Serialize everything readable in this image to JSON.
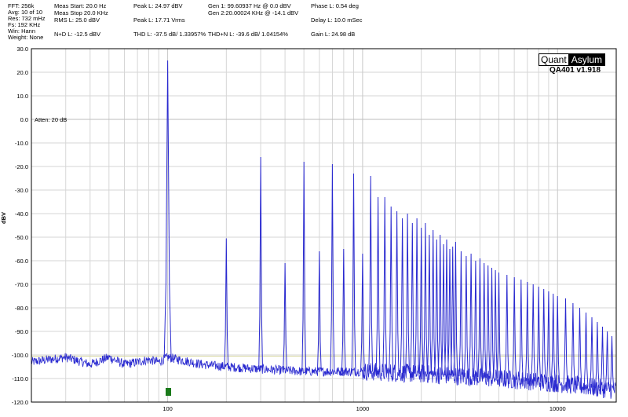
{
  "header": {
    "col1": [
      "FFT: 256k",
      "Avg: 10 of 10",
      "Res: 732 mHz",
      "Fs: 192 KHz",
      "Win: Hann",
      "Weight: None"
    ],
    "col2": [
      "Meas Start: 20.0 Hz",
      "Meas Stop 20.0 KHz",
      "RMS L: 25.0 dBV",
      "",
      "N+D L: -12.5 dBV"
    ],
    "col3": [
      "Peak L: 24.97 dBV",
      "",
      "Peak L: 17.71 Vrms",
      "",
      "THD L: -37.5 dB/ 1.33957%"
    ],
    "col4": [
      "Gen 1: 99.60937 Hz @ 0.0  dBV",
      "Gen 2:20.00024 KHz @ -14.1  dBV",
      "",
      "",
      "THD+N L: -39.6 dB/ 1.04154%"
    ],
    "col5": [
      "Phase L: 0.54 deg",
      "",
      "Delay L: 10.0 mSec",
      "",
      "Gain L: 24.98 dB"
    ]
  },
  "logo": {
    "quant": "Quant",
    "asylum": "Asylum",
    "version": "QA401 v1.918"
  },
  "annotation": "Atten: 20 dB",
  "colors": {
    "trace": "#2a2ad0",
    "grid": "#d6d6d6",
    "ref_line": "#d8d8a0",
    "marker": "#1a7a1a"
  },
  "chart_data": {
    "type": "line",
    "title": "",
    "xlabel": "",
    "ylabel": "dBV",
    "xscale": "log",
    "xlim": [
      20,
      20000
    ],
    "ylim": [
      -120,
      30
    ],
    "yticks": [
      30,
      20,
      10,
      0,
      -10,
      -20,
      -30,
      -40,
      -50,
      -60,
      -70,
      -80,
      -90,
      -100,
      -110,
      -120
    ],
    "ytick_labels": [
      "30.0",
      "20.0",
      "10.0",
      "0.0",
      "-10.0",
      "-20.0",
      "-30.0",
      "-40.0",
      "-50.0",
      "-60.0",
      "-70.0",
      "-80.0",
      "-90.0",
      "-100.0",
      "-110.0",
      "-120.0"
    ],
    "xticks": [
      100,
      1000,
      10000
    ],
    "xtick_labels": [
      "100",
      "1000",
      "10000"
    ],
    "grid": true,
    "reference_line_dbv": -100.5,
    "series": [
      {
        "harmonics": {
          "freq_hz": [
            100,
            200,
            300,
            400,
            500,
            600,
            700,
            800,
            900,
            1000,
            1100,
            1200,
            1300,
            1400,
            1500,
            1600,
            1700,
            1800,
            1900,
            2000,
            2100,
            2200,
            2300,
            2400,
            2500,
            2600,
            2700,
            2800,
            2900,
            3000,
            3200,
            3400,
            3600,
            3800,
            4000,
            4200,
            4400,
            4600,
            4800,
            5000,
            5500,
            6000,
            6500,
            7000,
            7500,
            8000,
            8500,
            9000,
            9500,
            10000,
            11000,
            12000,
            13000,
            14000,
            15000,
            16000,
            17000,
            18000,
            19000
          ],
          "level_dbv": [
            25,
            -50.5,
            -16,
            -61,
            -18,
            -56,
            -19,
            -55,
            -23,
            -57,
            -24,
            -33,
            -33,
            -37,
            -39,
            -42,
            -40,
            -44,
            -42,
            -46,
            -44,
            -49,
            -47,
            -51,
            -49,
            -53,
            -51,
            -55,
            -54,
            -52,
            -56,
            -58,
            -57,
            -60,
            -59,
            -61,
            -62,
            -63,
            -64,
            -65,
            -66,
            -67,
            -68,
            -69,
            -70,
            -71,
            -72,
            -73,
            -74,
            -75,
            -76,
            -78,
            -80,
            -82,
            -84,
            -86,
            -88,
            -90,
            -92
          ]
        },
        "noise_floor": {
          "freq_hz": [
            20,
            30,
            40,
            50,
            60,
            70,
            80,
            90,
            100,
            150,
            200,
            300,
            500,
            1000,
            2000,
            5000,
            10000,
            20000
          ],
          "level_dbv": [
            -103,
            -101,
            -104,
            -101,
            -104,
            -103,
            -102,
            -103,
            -101,
            -104,
            -105,
            -106,
            -107,
            -107,
            -108,
            -110,
            -112,
            -115
          ]
        }
      }
    ]
  }
}
